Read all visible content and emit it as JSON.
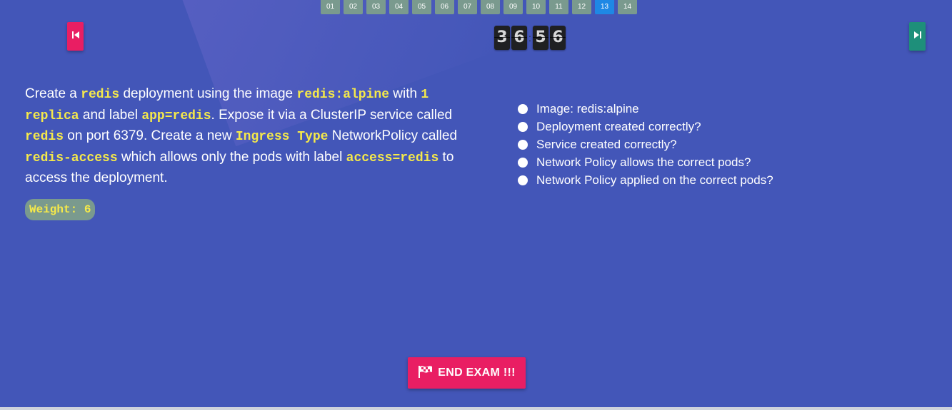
{
  "pager": {
    "questions": [
      "01",
      "02",
      "03",
      "04",
      "05",
      "06",
      "07",
      "08",
      "09",
      "10",
      "11",
      "12",
      "13",
      "14"
    ],
    "active": "13"
  },
  "navigation": {
    "prev_icon": "skip-previous-icon",
    "next_icon": "skip-next-icon"
  },
  "timer": {
    "minutes": [
      "3",
      "6"
    ],
    "seconds": [
      "5",
      "6"
    ]
  },
  "question": {
    "parts": [
      {
        "t": "Create a ",
        "code": false
      },
      {
        "t": "redis",
        "code": true
      },
      {
        "t": " deployment using the image ",
        "code": false
      },
      {
        "t": "redis:alpine",
        "code": true
      },
      {
        "t": " with ",
        "code": false
      },
      {
        "t": "1 replica",
        "code": true
      },
      {
        "t": " and label ",
        "code": false
      },
      {
        "t": "app=redis",
        "code": true
      },
      {
        "t": ". Expose it via a ClusterIP service called ",
        "code": false
      },
      {
        "t": "redis",
        "code": true
      },
      {
        "t": " on port 6379. Create a new ",
        "code": false
      },
      {
        "t": "Ingress Type",
        "code": true
      },
      {
        "t": " NetworkPolicy called ",
        "code": false
      },
      {
        "t": "redis-access",
        "code": true
      },
      {
        "t": " which allows only the pods with label ",
        "code": false
      },
      {
        "t": "access=redis",
        "code": true
      },
      {
        "t": " to access the deployment.",
        "code": false
      }
    ],
    "weight_label": "Weight: 6"
  },
  "checklist": [
    "Image: redis:alpine",
    "Deployment created correctly?",
    "Service created correctly?",
    "Network Policy allows the correct pods?",
    "Network Policy applied on the correct pods?"
  ],
  "end_exam": {
    "label": "END EXAM !!!",
    "icon": "flag-icon"
  },
  "colors": {
    "background": "#4356b8",
    "accent_pink": "#e91e63",
    "accent_teal": "#1e8f7a",
    "pager_active": "#1e88e5",
    "code_yellow": "#f5e94a"
  }
}
